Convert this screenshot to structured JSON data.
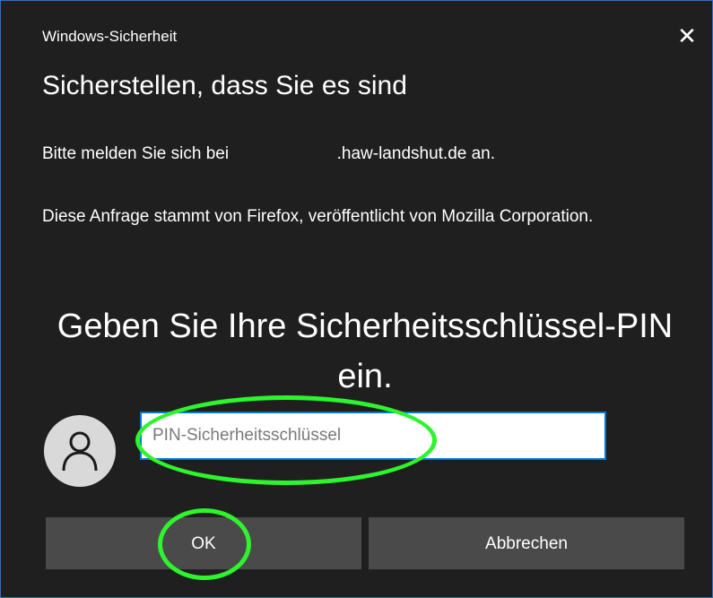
{
  "window": {
    "title": "Windows-Sicherheit",
    "close_symbol": "✕"
  },
  "dialog": {
    "heading": "Sicherstellen, dass Sie es sind",
    "signin_prefix": "Bitte melden Sie sich bei",
    "signin_suffix": ".haw-landshut.de an.",
    "request_source": "Diese Anfrage stammt von Firefox, veröffentlicht von Mozilla Corporation.",
    "prompt": "Geben Sie Ihre Sicherheitsschlüssel-PIN ein."
  },
  "pin_field": {
    "placeholder": "PIN-Sicherheitsschlüssel",
    "value": ""
  },
  "buttons": {
    "ok_label": "OK",
    "cancel_label": "Abbrechen"
  },
  "colors": {
    "dialog_background": "#1f1f1f",
    "button_background": "#4a4a4a",
    "input_border": "#0078d7",
    "highlight": "#2df52d"
  },
  "icons": {
    "avatar": "user-icon",
    "close": "close-icon"
  }
}
